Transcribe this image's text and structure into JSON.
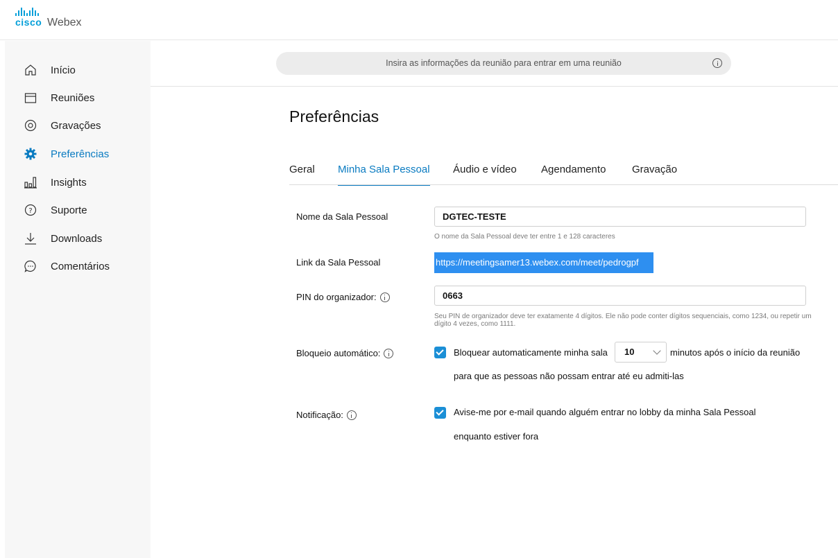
{
  "brand": {
    "company": "cisco",
    "product": "Webex"
  },
  "sidebar": {
    "items": [
      {
        "label": "Início",
        "icon": "home-icon"
      },
      {
        "label": "Reuniões",
        "icon": "calendar-icon"
      },
      {
        "label": "Gravações",
        "icon": "recording-icon"
      },
      {
        "label": "Preferências",
        "icon": "gear-icon",
        "active": true
      },
      {
        "label": "Insights",
        "icon": "insights-icon"
      },
      {
        "label": "Suporte",
        "icon": "help-icon"
      },
      {
        "label": "Downloads",
        "icon": "download-icon"
      },
      {
        "label": "Comentários",
        "icon": "comment-icon"
      }
    ]
  },
  "join": {
    "placeholder": "Insira as informações da reunião para entrar em uma reunião"
  },
  "page": {
    "title": "Preferências"
  },
  "tabs": [
    {
      "label": "Geral"
    },
    {
      "label": "Minha Sala Pessoal",
      "active": true
    },
    {
      "label": "Áudio e vídeo"
    },
    {
      "label": "Agendamento"
    },
    {
      "label": "Gravação"
    }
  ],
  "form": {
    "room_name": {
      "label": "Nome da Sala Pessoal",
      "value": "DGTEC-TESTE",
      "hint": "O nome da Sala Pessoal deve ter entre 1 e 128 caracteres"
    },
    "room_link": {
      "label": "Link da Sala Pessoal",
      "value": "https://meetingsamer13.webex.com/meet/pedrogpf"
    },
    "host_pin": {
      "label": "PIN do organizador:",
      "value": "0663",
      "hint": "Seu PIN de organizador deve ter exatamente 4 dígitos. Ele não pode conter dígitos sequenciais, como 1234, ou repetir um dígito 4 vezes, como 1111."
    },
    "auto_lock": {
      "label": "Bloqueio automático:",
      "checked": true,
      "text_before": "Bloquear automaticamente minha sala",
      "minutes": "10",
      "text_after": "minutos após o início da reunião",
      "text_line2": "para que as pessoas não possam entrar até eu admiti-las"
    },
    "notification": {
      "label": "Notificação:",
      "checked": true,
      "text_line1": "Avise-me por e-mail quando alguém entrar no lobby da minha Sala Pessoal",
      "text_line2": "enquanto estiver fora"
    }
  },
  "colors": {
    "accent": "#0a7bc1",
    "checkbox": "#1b8fd6",
    "selection": "#2e8ff0",
    "brand": "#049fd9"
  }
}
